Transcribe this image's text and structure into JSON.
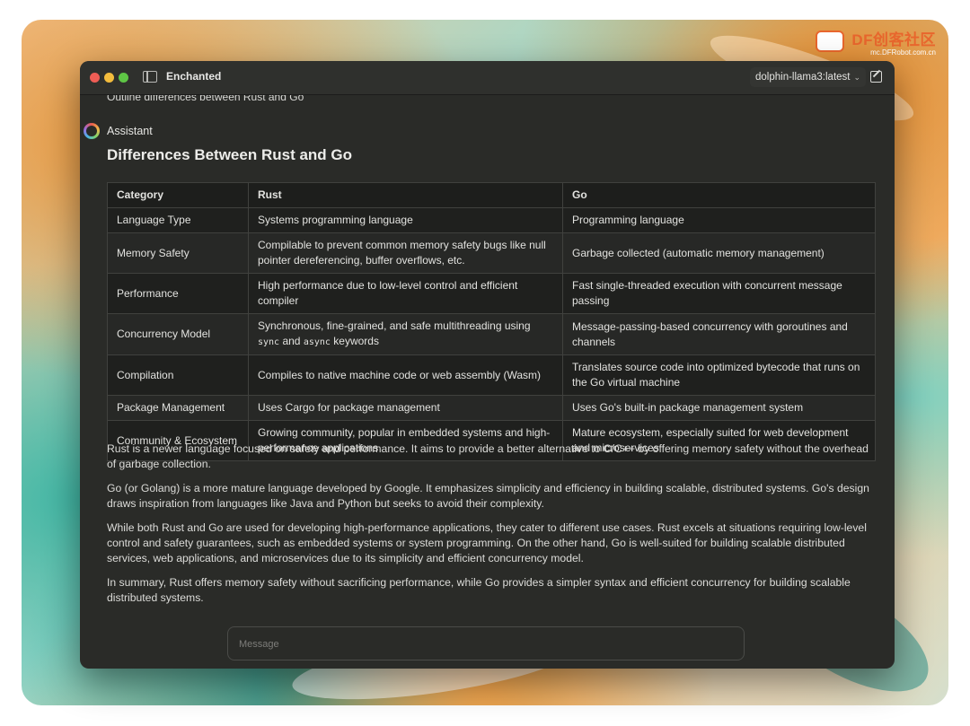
{
  "watermark": {
    "brand": "DF创客社区",
    "url": "mc.DFRobot.com.cn"
  },
  "window": {
    "title": "Enchanted",
    "model": "dolphin-llama3:latest"
  },
  "chat": {
    "user_message": "Outline differences between Rust and Go",
    "assistant_label": "Assistant",
    "heading": "Differences Between Rust and Go",
    "table": {
      "headers": [
        "Category",
        "Rust",
        "Go"
      ],
      "rows": [
        [
          "Language Type",
          "Systems programming language",
          "Programming language"
        ],
        [
          "Memory Safety",
          "Compilable to prevent common memory safety bugs like null pointer dereferencing, buffer overflows, etc.",
          "Garbage collected (automatic memory management)"
        ],
        [
          "Performance",
          "High performance due to low-level control and efficient compiler",
          "Fast single-threaded execution with concurrent message passing"
        ],
        [
          "Concurrency Model",
          "Synchronous, fine-grained, and safe multithreading using",
          "Message-passing-based concurrency with goroutines and channels"
        ],
        [
          "Compilation",
          "Compiles to native machine code or web assembly (Wasm)",
          "Translates source code into optimized bytecode that runs on the Go virtual machine"
        ],
        [
          "Package Management",
          "Uses Cargo for package management",
          "Uses Go's built-in package management system"
        ],
        [
          "Community & Ecosystem",
          "Growing community, popular in embedded systems and high-performance applications",
          "Mature ecosystem, especially suited for web development and microservices"
        ]
      ],
      "concurrency_code_1": "sync",
      "concurrency_and": "and",
      "concurrency_code_2": "async",
      "concurrency_tail": "keywords"
    },
    "paragraphs": [
      "Rust is a newer language focused on safety and performance. It aims to provide a better alternative to C/C++ by offering memory safety without the overhead of garbage collection.",
      "Go (or Golang) is a more mature language developed by Google. It emphasizes simplicity and efficiency in building scalable, distributed systems. Go's design draws inspiration from languages like Java and Python but seeks to avoid their complexity.",
      "While both Rust and Go are used for developing high-performance applications, they cater to different use cases. Rust excels at situations requiring low-level control and safety guarantees, such as embedded systems or system programming. On the other hand, Go is well-suited for building scalable distributed services, web applications, and microservices due to its simplicity and efficient concurrency model.",
      "In summary, Rust offers memory safety without sacrificing performance, while Go provides a simpler syntax and efficient concurrency for building scalable distributed systems."
    ]
  },
  "input": {
    "placeholder": "Message",
    "value": ""
  }
}
